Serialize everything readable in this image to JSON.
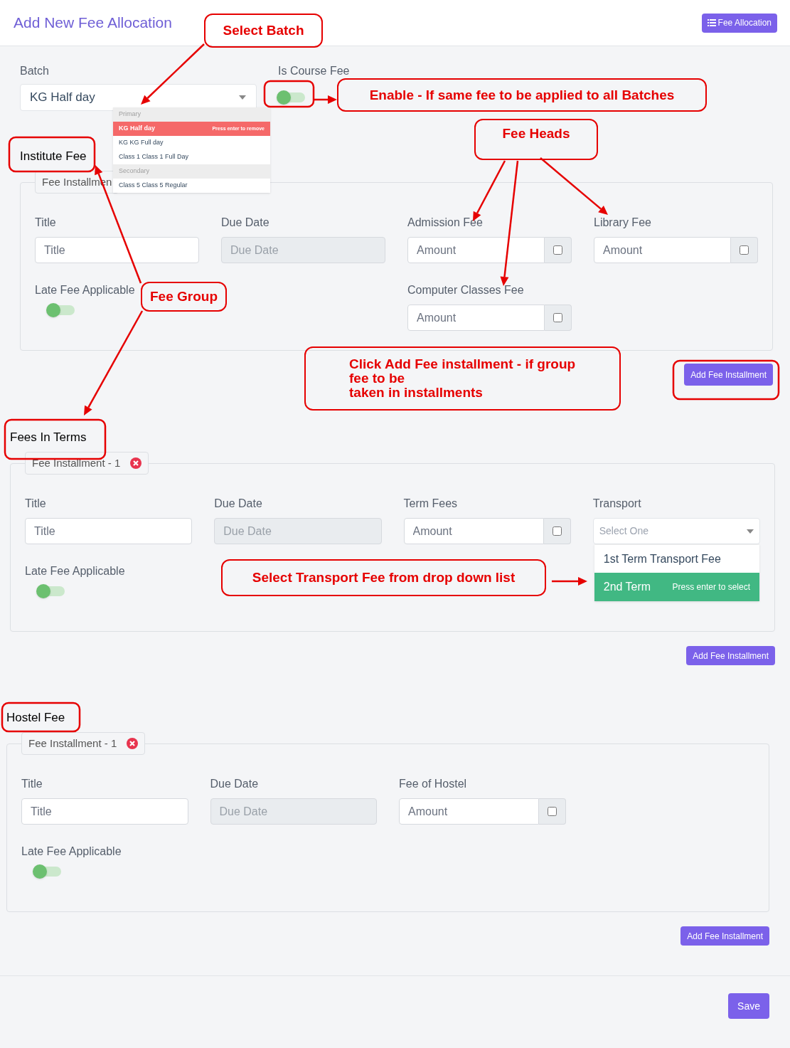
{
  "header": {
    "title": "Add New Fee Allocation",
    "button": "Fee Allocation"
  },
  "batch": {
    "label": "Batch",
    "value": "KG Half day",
    "dropdown": [
      {
        "group": "Primary",
        "options": [
          {
            "label": "KG Half day",
            "selected": true,
            "hint": "Press enter to remove"
          },
          {
            "label": "KG KG Full day",
            "selected": false
          },
          {
            "label": "Class 1 Class 1 Full Day",
            "selected": false
          }
        ]
      },
      {
        "group": "Secondary",
        "options": [
          {
            "label": "Class 5 Class 5 Regular",
            "selected": false
          }
        ]
      }
    ]
  },
  "course_fee": {
    "label": "Is Course Fee",
    "on": false
  },
  "fee_groups": [
    {
      "name": "Institute Fee",
      "legend": "Fee Installmen",
      "remove_icon": false,
      "add_button": "Add Fee Installment",
      "fields": [
        {
          "kind": "text",
          "label": "Title",
          "placeholder": "Title"
        },
        {
          "kind": "date",
          "label": "Due Date",
          "placeholder": "Due Date"
        },
        {
          "kind": "amount",
          "label": "Admission Fee",
          "placeholder": "Amount",
          "checked": false
        },
        {
          "kind": "amount",
          "label": "Library Fee",
          "placeholder": "Amount",
          "checked": false
        },
        {
          "kind": "toggle",
          "label": "Late Fee Applicable",
          "on": false
        },
        {
          "kind": "amount",
          "label": "Computer Classes Fee",
          "placeholder": "Amount",
          "checked": false
        }
      ]
    },
    {
      "name": "Fees In Terms",
      "legend": "Fee Installment - 1",
      "remove_icon": true,
      "add_button": "Add Fee Installment",
      "fields": [
        {
          "kind": "text",
          "label": "Title",
          "placeholder": "Title"
        },
        {
          "kind": "date",
          "label": "Due Date",
          "placeholder": "Due Date"
        },
        {
          "kind": "amount",
          "label": "Term Fees",
          "placeholder": "Amount",
          "checked": false
        },
        {
          "kind": "select",
          "label": "Transport",
          "placeholder": "Select One",
          "options": [
            {
              "label": "1st Term Transport Fee",
              "selected": false
            },
            {
              "label": "2nd Term",
              "selected": true,
              "hint": "Press enter to select"
            }
          ]
        },
        {
          "kind": "toggle",
          "label": "Late Fee Applicable",
          "on": false
        }
      ]
    },
    {
      "name": "Hostel Fee",
      "legend": "Fee Installment - 1",
      "remove_icon": true,
      "add_button": "Add Fee Installment",
      "fields": [
        {
          "kind": "text",
          "label": "Title",
          "placeholder": "Title"
        },
        {
          "kind": "date",
          "label": "Due Date",
          "placeholder": "Due Date"
        },
        {
          "kind": "amount",
          "label": "Fee of Hostel",
          "placeholder": "Amount",
          "checked": false
        },
        {
          "kind": "toggle",
          "label": "Late Fee Applicable",
          "on": false
        }
      ]
    }
  ],
  "save": "Save",
  "callouts": [
    {
      "lines": [
        "Select Batch"
      ]
    },
    {
      "lines": [
        "Enable - If same fee to be applied to all Batches"
      ]
    },
    {
      "lines": [
        "Fee Heads"
      ]
    },
    {
      "lines": [
        "Fee Group"
      ]
    },
    {
      "lines": [
        "Click Add Fee installment - if group",
        "fee to be",
        "taken in installments"
      ]
    },
    {
      "lines": [
        "Select Transport Fee from drop down list"
      ]
    }
  ]
}
